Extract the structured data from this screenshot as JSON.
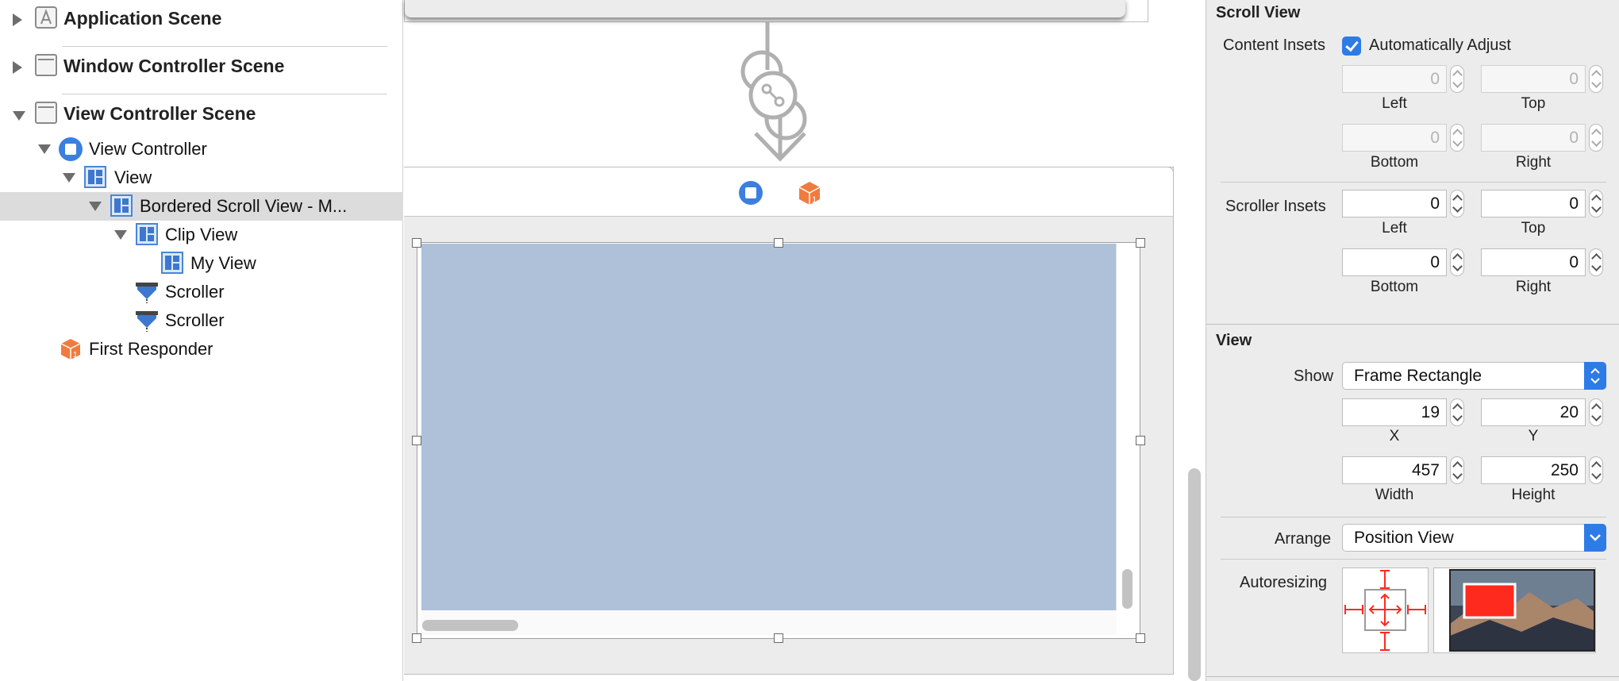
{
  "outline": {
    "scenes": [
      {
        "label": "Application Scene"
      },
      {
        "label": "Window Controller Scene"
      },
      {
        "label": "View Controller Scene"
      }
    ],
    "tree": [
      {
        "label": "View Controller"
      },
      {
        "label": "View"
      },
      {
        "label": "Bordered Scroll View - M..."
      },
      {
        "label": "Clip View"
      },
      {
        "label": "My View"
      },
      {
        "label": "Scroller"
      },
      {
        "label": "Scroller"
      },
      {
        "label": "First Responder"
      }
    ]
  },
  "inspector": {
    "scroll_view": {
      "title": "Scroll View",
      "content_insets_label": "Content Insets",
      "auto_adjust_label": "Automatically Adjust",
      "auto_adjust_checked": true,
      "content_insets": {
        "left": "0",
        "top": "0",
        "bottom": "0",
        "right": "0"
      },
      "scroller_insets_label": "Scroller Insets",
      "scroller_insets": {
        "left": "0",
        "top": "0",
        "bottom": "0",
        "right": "0"
      },
      "labels": {
        "left": "Left",
        "top": "Top",
        "bottom": "Bottom",
        "right": "Right"
      }
    },
    "view": {
      "title": "View",
      "show_label": "Show",
      "show_value": "Frame Rectangle",
      "x": "19",
      "y": "20",
      "width": "457",
      "height": "250",
      "x_label": "X",
      "y_label": "Y",
      "width_label": "Width",
      "height_label": "Height",
      "arrange_label": "Arrange",
      "arrange_value": "Position View",
      "autoresizing_label": "Autoresizing"
    }
  },
  "colors": {
    "accent": "#2d7be7",
    "selection": "#dcdcdc",
    "document_view": "#aec1d9",
    "autoresizing_red": "#ff2a1e"
  }
}
